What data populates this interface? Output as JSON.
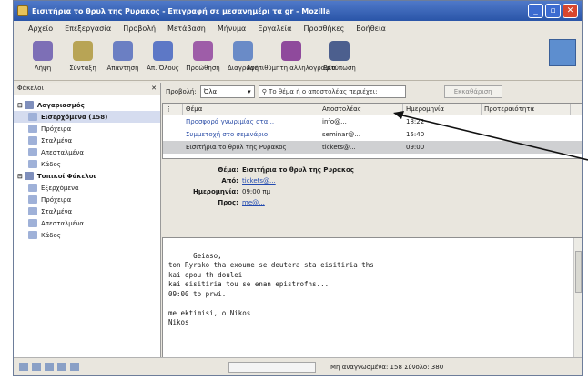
{
  "window": {
    "title": "Εισιτήρια το θρυλ της Ρυρακος - Επιγραφή σε μεσανημέρι τα gr - Mozilla"
  },
  "menu": [
    "Αρχείο",
    "Επεξεργασία",
    "Προβολή",
    "Μετάβαση",
    "Μήνυμα",
    "Εργαλεία",
    "Προσθήκες",
    "Βοήθεια"
  ],
  "toolbar": {
    "items": [
      {
        "label": "Λήψη",
        "icon": "get-mail-icon",
        "color": "#7d6fb6"
      },
      {
        "label": "Σύνταξη",
        "icon": "compose-icon",
        "color": "#b8a455"
      },
      {
        "label": "Απάντηση",
        "icon": "reply-icon",
        "color": "#6b7fc3"
      },
      {
        "label": "Απ. Όλους",
        "icon": "reply-all-icon",
        "color": "#5d78c6"
      },
      {
        "label": "Προώθηση",
        "icon": "forward-icon",
        "color": "#9e5da8"
      },
      {
        "label": "Διαγραφή",
        "icon": "delete-icon",
        "color": "#6a8bc7"
      },
      {
        "label": "Ανεπιθύμητη αλληλογραφία",
        "icon": "junk-icon",
        "color": "#8f4a9c"
      },
      {
        "label": "Εκτύπωση",
        "icon": "print-icon",
        "color": "#4c5f8e"
      }
    ]
  },
  "folders": {
    "header": "Φάκελοι",
    "items": [
      {
        "label": "Λογαριασμός",
        "level": 0,
        "bold": true
      },
      {
        "label": "Εισερχόμενα (158)",
        "level": 1,
        "bold": true,
        "selected": true
      },
      {
        "label": "Πρόχειρα",
        "level": 1
      },
      {
        "label": "Σταλμένα",
        "level": 1
      },
      {
        "label": "Απεσταλμένα",
        "level": 1
      },
      {
        "label": "Κάδος",
        "level": 1
      },
      {
        "label": "Τοπικοί Φάκελοι",
        "level": 0,
        "bold": true
      },
      {
        "label": "Εξερχόμενα",
        "level": 1
      },
      {
        "label": "Πρόχειρα",
        "level": 1
      },
      {
        "label": "Σταλμένα",
        "level": 1
      },
      {
        "label": "Απεσταλμένα",
        "level": 1
      },
      {
        "label": "Κάδος",
        "level": 1
      }
    ]
  },
  "search": {
    "label": "Προβολή:",
    "select_value": "Όλα",
    "placeholder": "Το θέμα ή ο αποστολέας περιέχει:",
    "clear_label": "Εκκαθάριση"
  },
  "messages": {
    "columns": [
      "Θέμα",
      "Αποστολέας",
      "Ημερομηνία",
      "Προτεραιότητα"
    ],
    "rows": [
      {
        "subject": "Προσφορά γνωριμίας στα...",
        "sender": "info@...",
        "date": "18:22"
      },
      {
        "subject": "Συμμετοχή στο σεμινάριο",
        "sender": "seminar@...",
        "date": "15:40"
      },
      {
        "subject": "Εισιτήρια το θρυλ της Ρυρακος",
        "sender": "tickets@...",
        "date": "09:00",
        "selected": true
      }
    ]
  },
  "header": {
    "subject_label": "Θέμα:",
    "subject_value": "Εισιτήρια το θρυλ της Ρυρακος",
    "from_label": "Από:",
    "from_value": "tickets@...",
    "date_label": "Ημερομηνία:",
    "date_value": "09:00 πμ",
    "to_label": "Προς:",
    "to_value": "me@..."
  },
  "body": {
    "text": "Geiaso,\nton Ryrako tha exoume se deutera sta eisitiria ths\nkai opou th doulei\nkai eisitiria tou se enan epistrofhs...\n09:00 to prwi.\n\nme ektimisi, o Nikos\nNikos"
  },
  "status": {
    "text": "Μη αναγνωσμένα: 158   Σύνολο: 380"
  }
}
